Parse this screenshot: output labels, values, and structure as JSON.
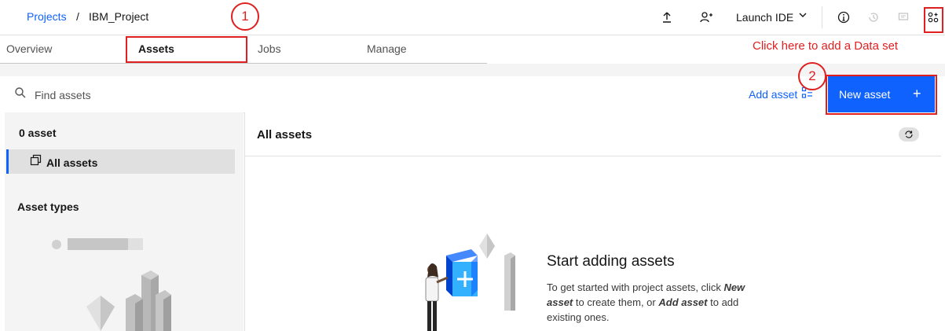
{
  "header": {
    "breadcrumb_root": "Projects",
    "breadcrumb_sep": "/",
    "project_name": "IBM_Project",
    "launch_ide": "Launch IDE"
  },
  "tabs": [
    {
      "label": "Overview"
    },
    {
      "label": "Assets"
    },
    {
      "label": "Jobs"
    },
    {
      "label": "Manage"
    }
  ],
  "toolbar": {
    "search_placeholder": "Find assets",
    "add_asset": "Add asset",
    "new_asset": "New asset",
    "new_asset_plus": "+"
  },
  "sidebar": {
    "asset_count": "0 asset",
    "all_assets": "All assets",
    "asset_types_heading": "Asset types"
  },
  "main": {
    "title": "All assets",
    "empty_title": "Start adding assets",
    "empty_desc_1": "To get started with project assets, click ",
    "empty_desc_new": "New asset",
    "empty_desc_2": " to create them, or ",
    "empty_desc_add": "Add asset",
    "empty_desc_3": " to add existing ones."
  },
  "annotations": {
    "step1": "1",
    "step2": "2",
    "hint": "Click here to add a Data set"
  },
  "colors": {
    "accent": "#0f62fe",
    "annotation": "#e02020"
  },
  "icons": [
    "upload-icon",
    "add-collaborator-icon",
    "chevron-down-icon",
    "info-icon",
    "history-icon",
    "comment-icon",
    "data-icon",
    "search-icon",
    "add-asset-icon",
    "all-assets-icon",
    "refresh-icon",
    "plus-icon"
  ]
}
